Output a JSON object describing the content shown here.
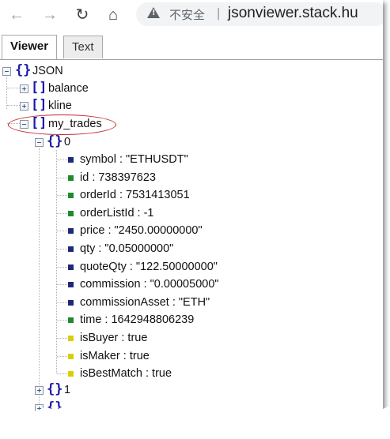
{
  "browser": {
    "back_icon": "arrow-left-icon",
    "forward_icon": "arrow-right-icon",
    "reload_icon": "reload-icon",
    "home_icon": "home-icon",
    "security_label": "不安全",
    "url": "jsonviewer.stack.hu"
  },
  "tabs": [
    {
      "label": "Viewer",
      "selected": true
    },
    {
      "label": "Text",
      "selected": false
    }
  ],
  "tree": {
    "root": "JSON",
    "nodes": [
      {
        "key": "balance",
        "type": "array",
        "expanded": false
      },
      {
        "key": "kline",
        "type": "array",
        "expanded": false
      },
      {
        "key": "my_trades",
        "type": "array",
        "expanded": true
      }
    ],
    "trade0_index": "0",
    "trade0_fields": [
      {
        "text": "symbol : \"ETHUSDT\"",
        "kind": "string"
      },
      {
        "text": "id : 738397623",
        "kind": "number"
      },
      {
        "text": "orderId : 7531413051",
        "kind": "number"
      },
      {
        "text": "orderListId : -1",
        "kind": "number"
      },
      {
        "text": "price : \"2450.00000000\"",
        "kind": "string"
      },
      {
        "text": "qty : \"0.05000000\"",
        "kind": "string"
      },
      {
        "text": "quoteQty : \"122.50000000\"",
        "kind": "string"
      },
      {
        "text": "commission : \"0.00005000\"",
        "kind": "string"
      },
      {
        "text": "commissionAsset : \"ETH\"",
        "kind": "string"
      },
      {
        "text": "time : 1642948806239",
        "kind": "number"
      },
      {
        "text": "isBuyer : true",
        "kind": "boolean"
      },
      {
        "text": "isMaker : true",
        "kind": "boolean"
      },
      {
        "text": "isBestMatch : true",
        "kind": "boolean"
      }
    ],
    "trade1_index": "1"
  },
  "colors": {
    "string_marker": "#1e2a78",
    "number_marker": "#1f8a2e",
    "boolean_marker": "#d8cf0a",
    "highlight": "#c0262d"
  }
}
